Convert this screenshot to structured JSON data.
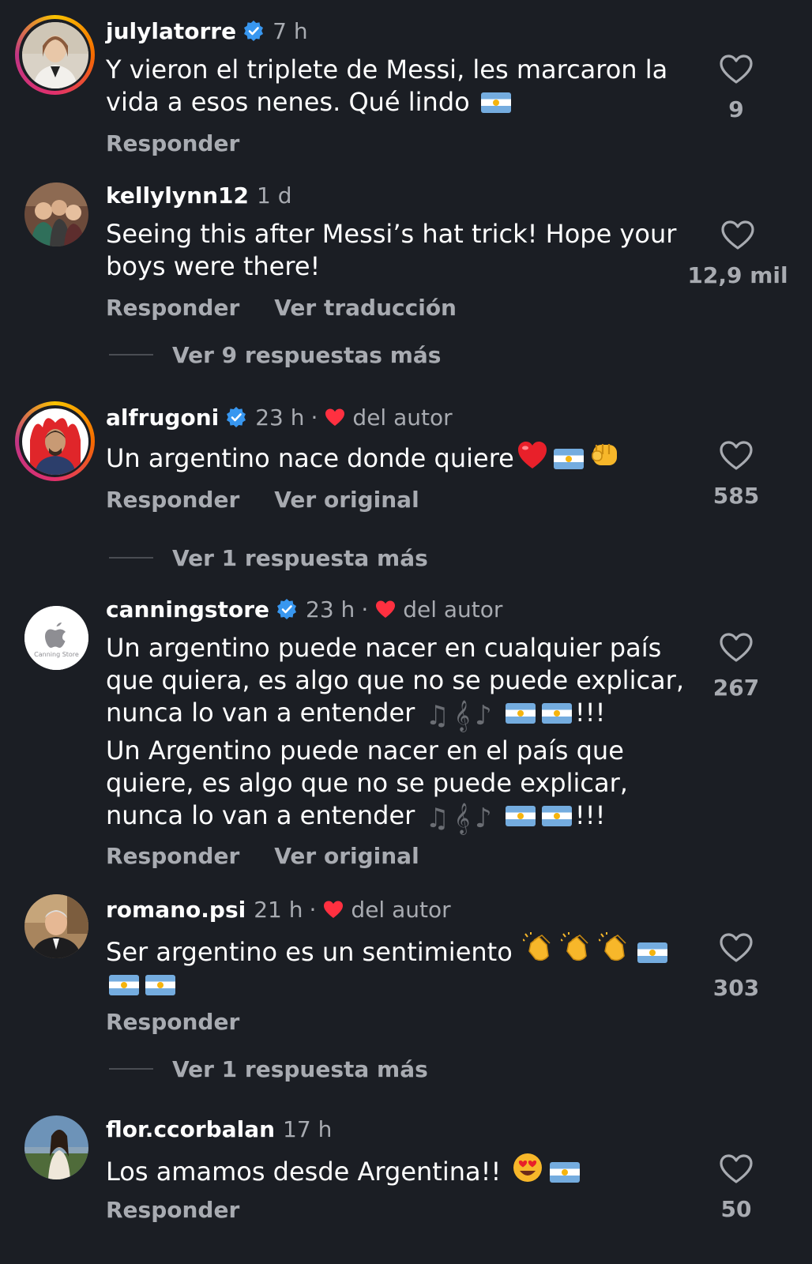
{
  "comments": [
    {
      "username": "julylatorre",
      "verified": true,
      "time": "7 h",
      "author_liked": false,
      "text": "Y vieron el triplete de Messi, les marcaron la vida a esos nenes. Qué lindo",
      "emojis": [
        "flag-argentina"
      ],
      "likes": "9",
      "actions": [
        "Responder"
      ]
    },
    {
      "username": "kellylynn12",
      "verified": false,
      "time": "1 d",
      "author_liked": false,
      "text": "Seeing this after Messi’s hat trick! Hope your boys were there!",
      "likes": "12,9 mil",
      "actions": [
        "Responder",
        "Ver traducción"
      ],
      "more_replies": "Ver 9 respuestas más"
    },
    {
      "username": "alfrugoni",
      "verified": true,
      "time": "23 h",
      "author_liked": true,
      "author_label": "del autor",
      "text": "Un argentino nace donde quiere",
      "emojis": [
        "red-heart",
        "flag-argentina",
        "fist"
      ],
      "likes": "585",
      "actions": [
        "Responder",
        "Ver original"
      ],
      "more_replies": "Ver 1 respuesta más"
    },
    {
      "username": "canningstore",
      "verified": true,
      "time": "23 h",
      "author_liked": true,
      "author_label": "del autor",
      "text": "Un argentino puede nacer en cualquier país que quiera, es algo que no se puede explicar, nunca lo van a entender",
      "text_suffix": "!!!",
      "text2": " Un Argentino puede nacer en el país que quiere, es algo que no se puede explicar, nunca lo van a entender",
      "text2_suffix": "!!!",
      "emojis": [
        "musical-notes",
        "musical-score",
        "musical-note",
        "flag-argentina",
        "flag-argentina"
      ],
      "avatar_caption": "Canning Store",
      "likes": "267",
      "actions": [
        "Responder",
        "Ver original"
      ]
    },
    {
      "username": "romano.psi",
      "verified": false,
      "time": "21 h",
      "author_liked": true,
      "author_label": "del autor",
      "text": "Ser argentino es un sentimiento",
      "emojis": [
        "clapping-hands",
        "clapping-hands",
        "clapping-hands",
        "flag-argentina",
        "flag-argentina",
        "flag-argentina"
      ],
      "likes": "303",
      "actions": [
        "Responder"
      ],
      "more_replies": "Ver 1 respuesta más"
    },
    {
      "username": "flor.ccorbalan",
      "verified": false,
      "time": "17 h",
      "author_liked": false,
      "text": "Los amamos desde Argentina!!",
      "emojis": [
        "heart-eyes-face",
        "flag-argentina"
      ],
      "likes": "50",
      "actions": [
        "Responder"
      ]
    }
  ],
  "colors": {
    "background": "#1b1e24",
    "text": "#ffffff",
    "secondary_text": "#a8abb1",
    "verified_badge": "#3897f0",
    "author_heart": "#ff3040"
  }
}
